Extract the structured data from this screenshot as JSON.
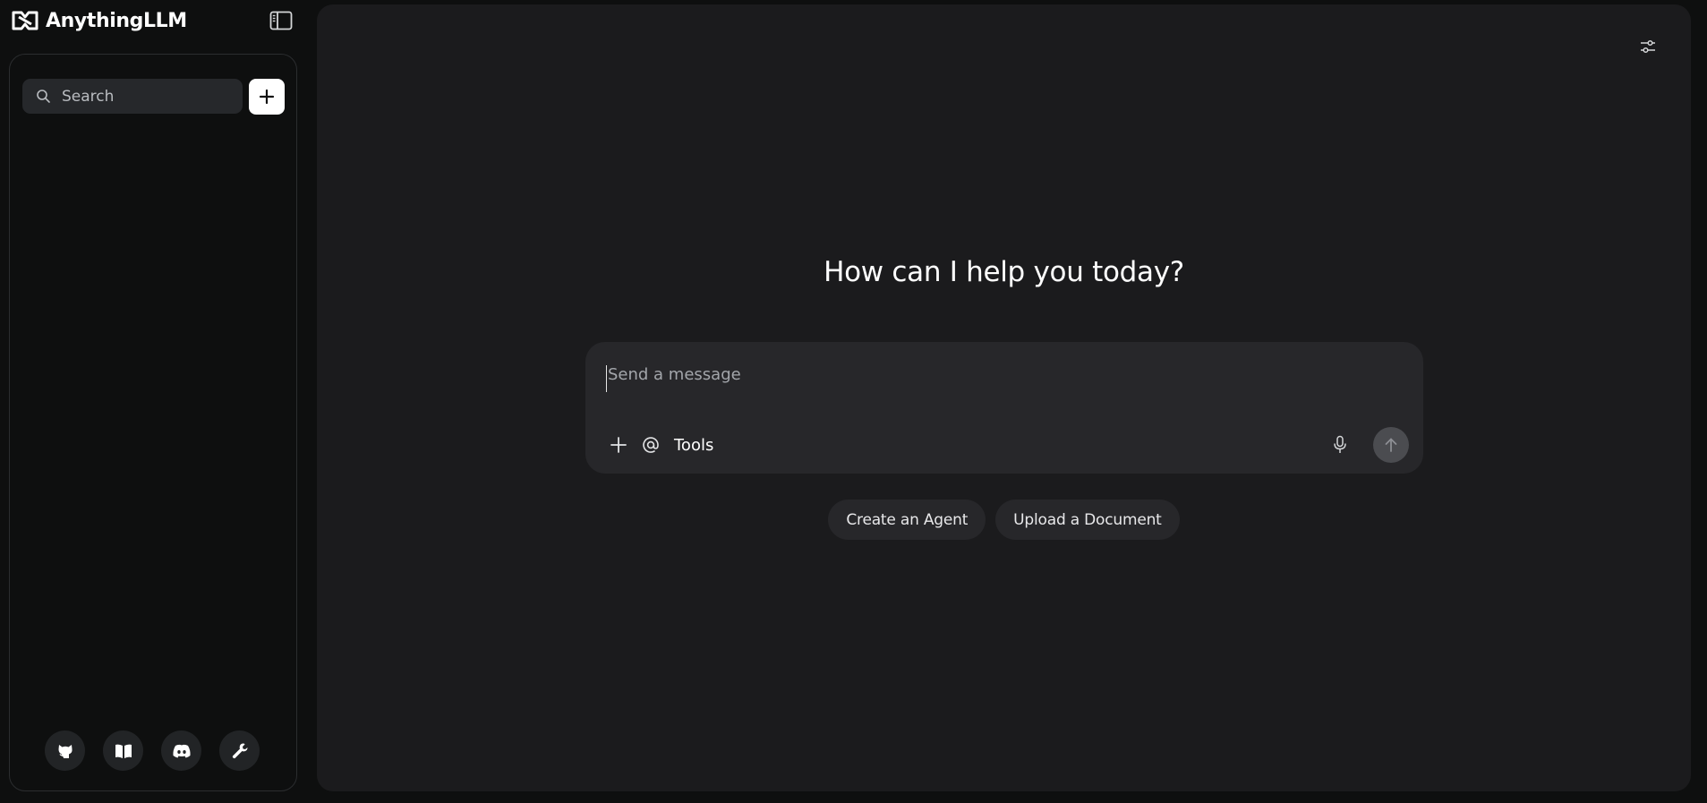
{
  "brand": {
    "name": "AnythingLLM"
  },
  "sidebar": {
    "search": {
      "placeholder": "Search"
    },
    "footer_icons": [
      "github-icon",
      "docs-book-icon",
      "discord-icon",
      "wrench-icon"
    ]
  },
  "main": {
    "greeting": "How can I help you today?",
    "composer": {
      "placeholder": "Send a message",
      "tools_label": "Tools"
    },
    "suggestions": [
      "Create an Agent",
      "Upload a Document"
    ]
  },
  "colors": {
    "background": "#0e0f0f",
    "main_panel": "#1b1b1d",
    "composer": "#27272a",
    "accent": "#ffffff"
  }
}
